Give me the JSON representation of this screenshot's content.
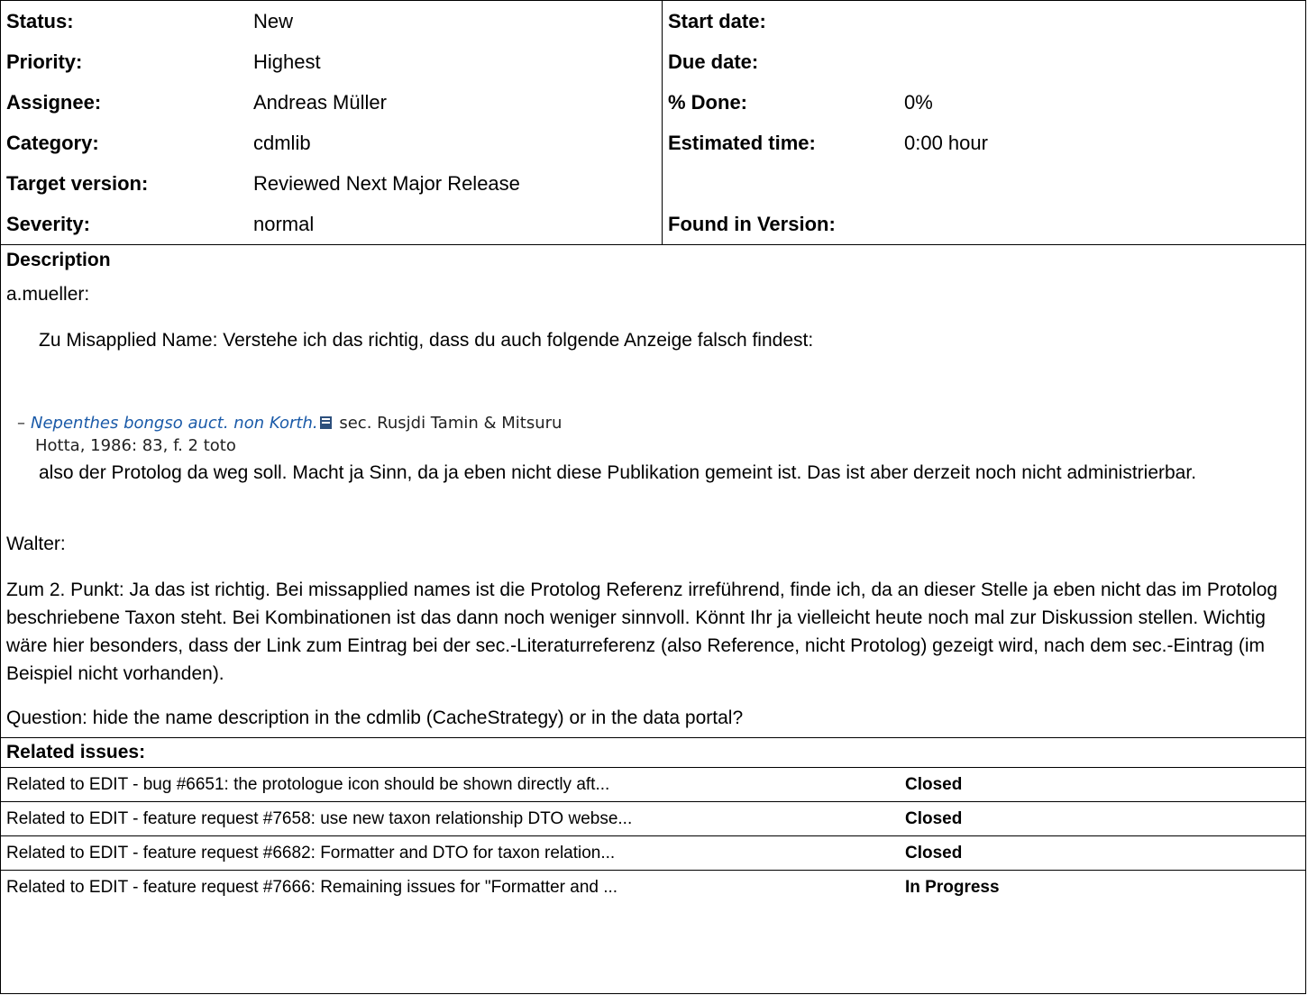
{
  "attributes": {
    "rows": [
      {
        "l1": "Status:",
        "v1": "New",
        "l2": "Start date:",
        "v2": ""
      },
      {
        "l1": "Priority:",
        "v1": "Highest",
        "l2": "Due date:",
        "v2": ""
      },
      {
        "l1": "Assignee:",
        "v1": "Andreas Müller",
        "l2": "% Done:",
        "v2": "0%"
      },
      {
        "l1": "Category:",
        "v1": "cdmlib",
        "l2": "Estimated time:",
        "v2": "0:00 hour"
      },
      {
        "l1": "Target version:",
        "v1": "Reviewed Next Major Release",
        "l2": "",
        "v2": ""
      },
      {
        "l1": "Severity:",
        "v1": "normal",
        "l2": "Found in Version:",
        "v2": ""
      }
    ]
  },
  "description": {
    "heading": "Description",
    "author1": "a.mueller:",
    "quote1": "Zu Misapplied Name: Verstehe ich das richtig, dass du auch folgende Anzeige falsch findest:",
    "shot_dash": "–",
    "shot_link": "Nepenthes bongso auct. non Korth.",
    "shot_sec": "sec. Rusjdi Tamin & Mitsuru",
    "shot_line2": "Hotta, 1986: 83, f. 2 toto",
    "quote2": "also der Protolog da weg soll. Macht ja Sinn, da ja eben nicht diese Publikation gemeint ist. Das ist aber derzeit noch nicht administrierbar.",
    "author2": "Walter:",
    "para": "Zum 2. Punkt: Ja das ist richtig. Bei missapplied names ist die Protolog Referenz irreführend, finde ich, da an dieser Stelle ja eben nicht das im Protolog beschriebene Taxon steht. Bei Kombinationen ist das dann noch weniger sinnvoll. Könnt Ihr ja vielleicht heute noch mal zur Diskussion stellen. Wichtig wäre hier besonders, dass der Link zum Eintrag bei der sec.-Literaturreferenz (also Reference, nicht Protolog) gezeigt wird, nach dem sec.-Eintrag (im Beispiel nicht vorhanden).",
    "question": "Question: hide the name description in the cdmlib (CacheStrategy) or in the data portal?"
  },
  "related": {
    "heading": "Related issues:",
    "items": [
      {
        "text": "Related to EDIT - bug #6651: the protologue icon should be shown directly aft...",
        "status": "Closed"
      },
      {
        "text": "Related to EDIT - feature request #7658: use new taxon relationship DTO webse...",
        "status": "Closed"
      },
      {
        "text": "Related to EDIT - feature request #6682: Formatter and DTO for taxon relation...",
        "status": "Closed"
      },
      {
        "text": "Related to EDIT - feature request #7666: Remaining issues for \"Formatter and ...",
        "status": "In Progress"
      }
    ]
  }
}
